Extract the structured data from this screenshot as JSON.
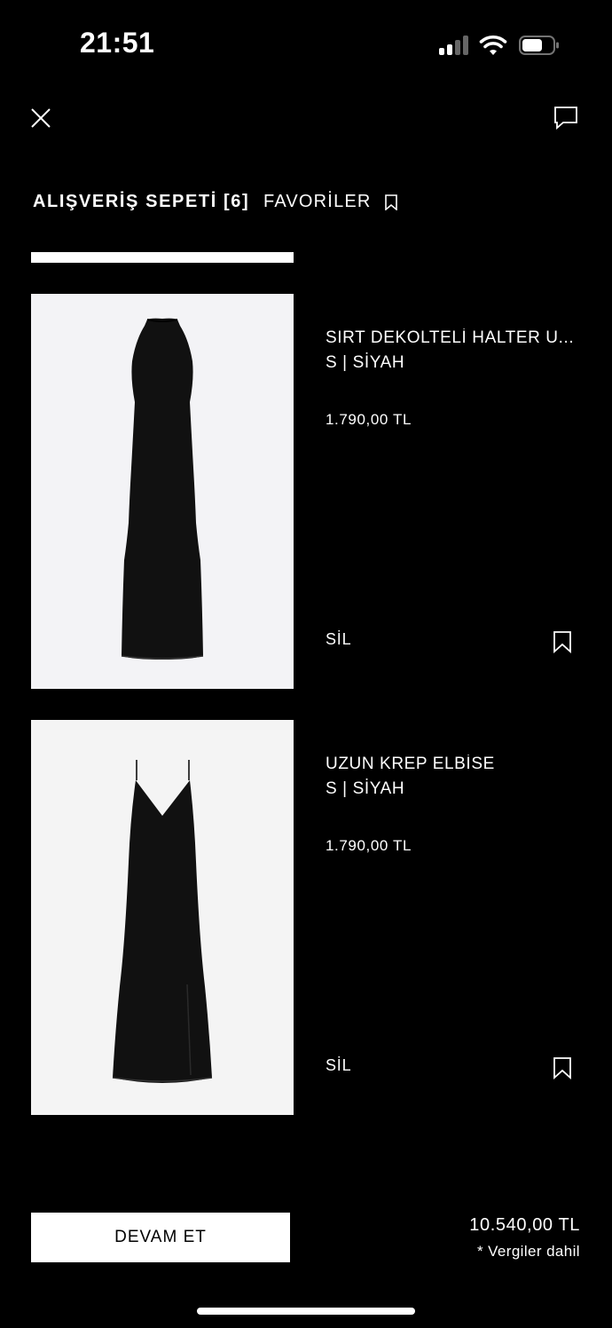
{
  "status_bar": {
    "time": "21:51"
  },
  "header": {
    "close_icon": "close-icon",
    "chat_icon": "chat-icon"
  },
  "tabs": {
    "cart_label": "ALIŞVERİŞ SEPETİ [6]",
    "favorites_label": "FAVORİLER"
  },
  "cart_items": [
    {
      "name": "SIRT DEKOLTELİ HALTER U...",
      "variant": "S | SİYAH",
      "price": "1.790,00 TL",
      "remove_label": "SİL"
    },
    {
      "name": "UZUN KREP ELBİSE",
      "variant": "S | SİYAH",
      "price": "1.790,00 TL",
      "remove_label": "SİL"
    }
  ],
  "footer": {
    "continue_label": "DEVAM ET",
    "total": "10.540,00 TL",
    "tax_note": "* Vergiler dahil"
  },
  "colors": {
    "background": "#000000",
    "text": "#ffffff",
    "button_bg": "#ffffff",
    "button_text": "#000000",
    "product_bg_1": "#f3f3f6",
    "product_bg_2": "#f4f4f4"
  }
}
